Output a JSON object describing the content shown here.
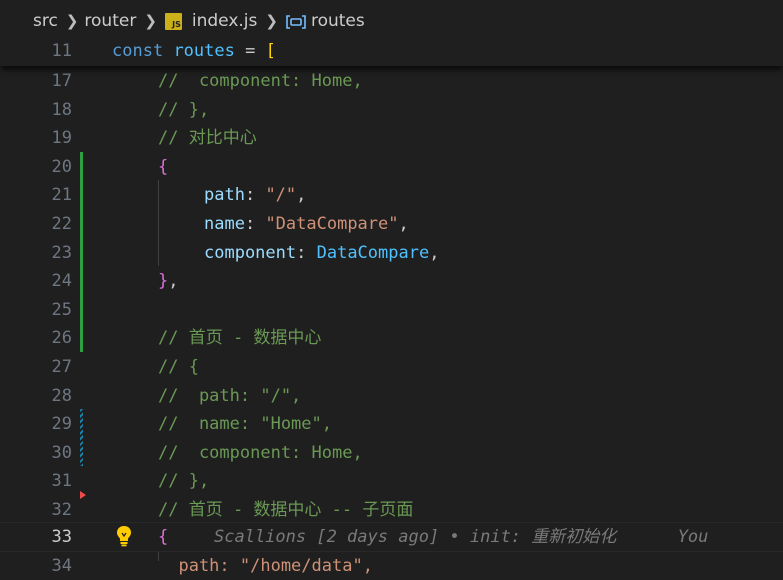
{
  "breadcrumb": {
    "items": [
      "src",
      "router",
      "index.js",
      "routes"
    ],
    "js_badge": "JS"
  },
  "sticky": {
    "line_number": "11",
    "kw": "const",
    "name": "routes",
    "op": " = ",
    "bracket": "["
  },
  "lines": [
    {
      "n": "17",
      "t": "//  component: Home,"
    },
    {
      "n": "18",
      "t": "// },"
    },
    {
      "n": "19",
      "t": "// 对比中心"
    },
    {
      "n": "20",
      "t": "{"
    },
    {
      "n": "21",
      "prop": "path",
      "val": "\"/\"",
      "sep": ": ",
      "end": ","
    },
    {
      "n": "22",
      "prop": "name",
      "val": "\"DataCompare\"",
      "sep": ": ",
      "end": ","
    },
    {
      "n": "23",
      "prop": "component",
      "val": "DataCompare",
      "sep": ": ",
      "end": ","
    },
    {
      "n": "24",
      "t": "},"
    },
    {
      "n": "25",
      "t": ""
    },
    {
      "n": "26",
      "t": "// 首页 - 数据中心"
    },
    {
      "n": "27",
      "t": "// {"
    },
    {
      "n": "28",
      "t": "//  path: \"/\","
    },
    {
      "n": "29",
      "t": "//  name: \"Home\","
    },
    {
      "n": "30",
      "t": "//  component: Home,"
    },
    {
      "n": "31",
      "t": "// },"
    },
    {
      "n": "32",
      "t": "// 首页 - 数据中心 -- 子页面"
    },
    {
      "n": "33",
      "t": "{"
    },
    {
      "n": "34",
      "t": "  path: \"/home/data\","
    }
  ],
  "blame": "Scallions [2 days ago] • init: 重新初始化      You",
  "colors": {
    "added": "#2ea043",
    "modified": "#1b81a8",
    "deleted": "#f14c4c",
    "comment": "#6a9955",
    "string": "#ce9178",
    "keyword": "#569cd6"
  },
  "icons": [
    "chevron-right-icon",
    "javascript-file-icon",
    "variable-icon",
    "lightbulb-icon"
  ]
}
